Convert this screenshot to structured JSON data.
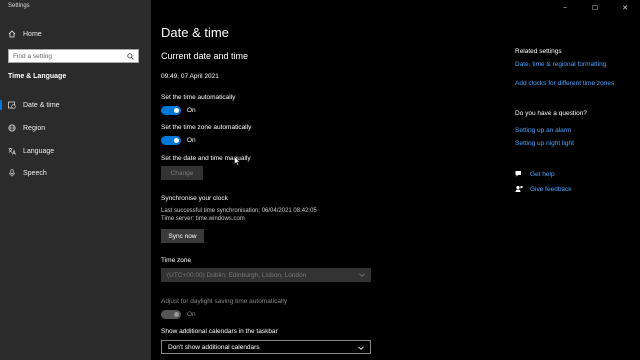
{
  "app": {
    "title": "Settings"
  },
  "window_controls": {
    "minimize": "−",
    "maximize": "☐",
    "close": "✕"
  },
  "sidebar": {
    "home_label": "Home",
    "search_placeholder": "Find a setting",
    "section_label": "Time & Language",
    "items": [
      {
        "label": "Date & time",
        "icon": "clock-calendar-icon",
        "active": true
      },
      {
        "label": "Region",
        "icon": "globe-icon",
        "active": false
      },
      {
        "label": "Language",
        "icon": "language-icon",
        "active": false
      },
      {
        "label": "Speech",
        "icon": "microphone-icon",
        "active": false
      }
    ]
  },
  "main": {
    "page_title": "Date & time",
    "current_heading": "Current date and time",
    "current_value": "09:49, 07 April 2021",
    "auto_time": {
      "label": "Set the time automatically",
      "state": "On"
    },
    "auto_zone": {
      "label": "Set the time zone automatically",
      "state": "On"
    },
    "manual": {
      "label": "Set the date and time manually",
      "button": "Change"
    },
    "sync": {
      "heading": "Synchronise your clock",
      "last_sync": "Last successful time synchronisation: 06/04/2021 08:42:05",
      "server": "Time server: time.windows.com",
      "button": "Sync now"
    },
    "timezone": {
      "label": "Time zone",
      "value": "(UTC+00:00) Dublin, Edinburgh, Lisbon, London"
    },
    "dst": {
      "label": "Adjust for daylight saving time automatically",
      "state": "On"
    },
    "calendars": {
      "label": "Show additional calendars in the taskbar",
      "value": "Don't show additional calendars"
    }
  },
  "related": {
    "heading": "Related settings",
    "links": [
      "Date, time & regional formatting",
      "Add clocks for different time zones"
    ]
  },
  "question": {
    "heading": "Do you have a question?",
    "links": [
      "Setting up an alarm",
      "Setting up night light"
    ]
  },
  "help": {
    "get_help": "Get help",
    "give_feedback": "Give feedback"
  },
  "colors": {
    "accent": "#0078d7",
    "link": "#4aa3ff",
    "sidebar_bg": "#2b2b2b",
    "main_bg": "#000000"
  }
}
